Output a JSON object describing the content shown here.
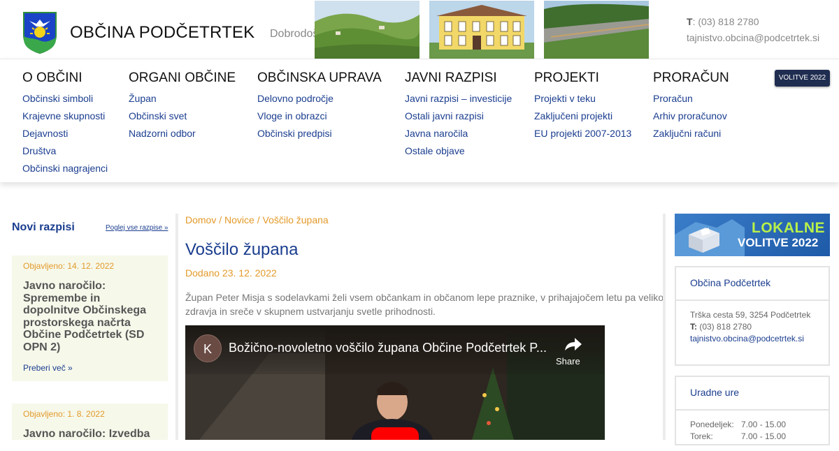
{
  "header": {
    "site_title": "OBČINA PODČETRTEK",
    "welcome": "Dobrodošli",
    "contact": {
      "phone_label": "T",
      "phone": ": (03) 818 2780",
      "email": "tajnistvo.obcina@podcetrtek.si"
    }
  },
  "nav": {
    "columns": [
      {
        "title": "O OBČINI",
        "links": [
          "Občinski simboli",
          "Krajevne skupnosti",
          "Dejavnosti",
          "Društva",
          "Občinski nagrajenci"
        ]
      },
      {
        "title": "ORGANI OBČINE",
        "links": [
          "Župan",
          "Občinski svet",
          "Nadzorni odbor"
        ]
      },
      {
        "title": "OBČINSKA UPRAVA",
        "links": [
          "Delovno področje",
          "Vloge in obrazci",
          "Občinski predpisi"
        ]
      },
      {
        "title": "JAVNI RAZPISI",
        "links": [
          "Javni razpisi – investicije",
          "Ostali javni razpisi",
          "Javna naročila",
          "Ostale objave"
        ]
      },
      {
        "title": "PROJEKTI",
        "links": [
          "Projekti v teku",
          "Zaključeni projekti",
          "EU projekti 2007-2013"
        ]
      },
      {
        "title": "PRORAČUN",
        "links": [
          "Proračun",
          "Arhiv proračunov",
          "Zaključni računi"
        ]
      }
    ],
    "badge": "VOLITVE 2022"
  },
  "left": {
    "title": "Novi razpisi",
    "view_all": "Poglej vse razpise »",
    "cards": [
      {
        "date": "Objavljeno: 14. 12. 2022",
        "title": "Javno naročilo: Spremembe in dopolnitve Občinskega prostorskega načrta Občine Podčetrtek (SD OPN 2)",
        "more": "Preberi več »"
      },
      {
        "date": "Objavljeno: 1. 8. 2022",
        "title": "Javno naročilo: Izvedba",
        "more": ""
      }
    ]
  },
  "main": {
    "breadcrumb": [
      "Domov",
      "Novice",
      "Voščilo župana"
    ],
    "breadcrumb_sep": " / ",
    "title": "Voščilo župana",
    "posted": "Dodano 23. 12. 2022",
    "lead": "Župan Peter Misja s sodelavkami želi vsem občankam in občanom lepe praznike, v prihajajočem letu pa veliko zdravja in sreče v skupnem ustvarjanju svetle prihodnosti.",
    "video": {
      "channel_initial": "K",
      "title": "Božično-novoletno voščilo župana Občine Podčetrtek P...",
      "share": "Share"
    }
  },
  "right": {
    "banner": {
      "line1": "LOKALNE",
      "line2": "VOLITVE 2022"
    },
    "contact_box": {
      "title": "Občina Podčetrtek",
      "address": "Trška cesta 59, 3254 Podčetrtek",
      "phone_label": "T:",
      "phone": " (03) 818 2780",
      "email": "tajnistvo.obcina@podcetrtek.si"
    },
    "hours_box": {
      "title": "Uradne ure",
      "rows": [
        {
          "day": "Ponedeljek:",
          "time": "7.00 - 15.00"
        },
        {
          "day": "Torek:",
          "time": "7.00 - 15.00"
        }
      ]
    }
  },
  "colors": {
    "link_blue": "#1a3d8f",
    "accent_orange": "#e39a2a",
    "card_bg": "#f6f8ea",
    "badge_dark": "#1f2d50"
  },
  "icons": [
    "coat-of-arms-logo",
    "share-icon",
    "play-icon",
    "ballot-box-icon"
  ]
}
